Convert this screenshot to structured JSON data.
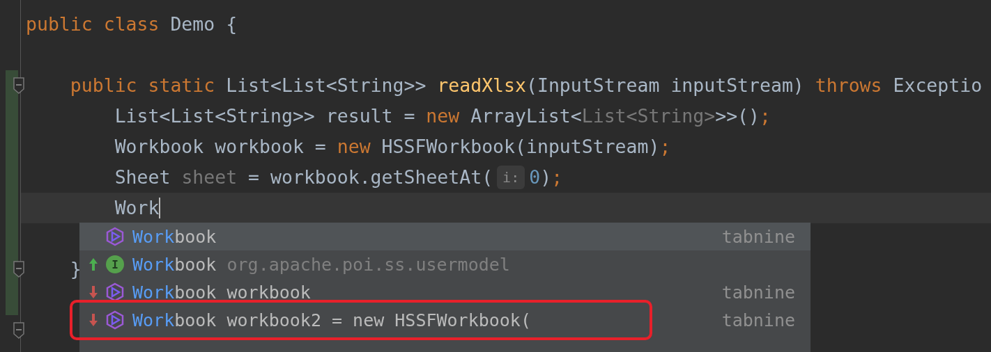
{
  "editor": {
    "lines": [
      {
        "kind": "code",
        "tokens": [
          {
            "text": "public class",
            "kind": "keyword"
          },
          {
            "text": " Demo {",
            "kind": "plain"
          }
        ]
      },
      {
        "kind": "blank"
      },
      {
        "kind": "code",
        "fold": true,
        "changed": true,
        "tokens": [
          {
            "text": "    public static",
            "kind": "keyword"
          },
          {
            "text": " List<List<String>> ",
            "kind": "plain"
          },
          {
            "text": "readXlsx",
            "kind": "method"
          },
          {
            "text": "(InputStream inputStream) ",
            "kind": "plain"
          },
          {
            "text": "throws",
            "kind": "keyword"
          },
          {
            "text": " Exceptio",
            "kind": "plain"
          }
        ]
      },
      {
        "kind": "code",
        "changed": true,
        "tokens": [
          {
            "text": "        List<List<String>> result = ",
            "kind": "plain"
          },
          {
            "text": "new",
            "kind": "keyword"
          },
          {
            "text": " ArrayList<",
            "kind": "plain"
          },
          {
            "text": "List<String>",
            "kind": "muted"
          },
          {
            "text": ">>()",
            "kind": "plain"
          },
          {
            "text": ";",
            "kind": "keyword"
          }
        ]
      },
      {
        "kind": "code",
        "changed": true,
        "tokens": [
          {
            "text": "        Workbook workbook = ",
            "kind": "plain"
          },
          {
            "text": "new",
            "kind": "keyword"
          },
          {
            "text": " HSSFWorkbook(inputStream)",
            "kind": "plain"
          },
          {
            "text": ";",
            "kind": "keyword"
          }
        ]
      },
      {
        "kind": "code",
        "changed": true,
        "tokens": [
          {
            "text": "        Sheet ",
            "kind": "plain"
          },
          {
            "text": "sheet",
            "kind": "muted"
          },
          {
            "text": " = workbook.getSheetAt(",
            "kind": "plain"
          },
          {
            "text": "i:",
            "kind": "hint"
          },
          {
            "text": "0",
            "kind": "number"
          },
          {
            "text": ")",
            "kind": "plain"
          },
          {
            "text": ";",
            "kind": "keyword"
          }
        ]
      },
      {
        "kind": "code",
        "changed": true,
        "current": true,
        "caret": true,
        "tokens": [
          {
            "text": "        Work",
            "kind": "plain"
          }
        ]
      },
      {
        "kind": "blank",
        "changed": true
      },
      {
        "kind": "code",
        "fold": true,
        "changed": true,
        "tokens": [
          {
            "text": "    }",
            "kind": "plain"
          }
        ]
      },
      {
        "kind": "blank",
        "changed": true
      },
      {
        "kind": "blank",
        "fold": true
      }
    ]
  },
  "completion": {
    "items": [
      {
        "kind": "tabnine",
        "match": "Work",
        "rest": "book",
        "source": "tabnine",
        "selected": true
      },
      {
        "kind": "interface",
        "badge": "I",
        "up": true,
        "match": "Work",
        "rest": "book",
        "detail": " org.apache.poi.ss.usermodel",
        "selected": false
      },
      {
        "kind": "tabnine",
        "down": true,
        "match": "Work",
        "rest": "book workbook",
        "source": "tabnine",
        "selected": false
      },
      {
        "kind": "tabnine",
        "down": true,
        "match": "Work",
        "rest": "book workbook2 = new HSSFWorkbook(",
        "source": "tabnine",
        "selected": false,
        "outlined": true
      }
    ]
  }
}
